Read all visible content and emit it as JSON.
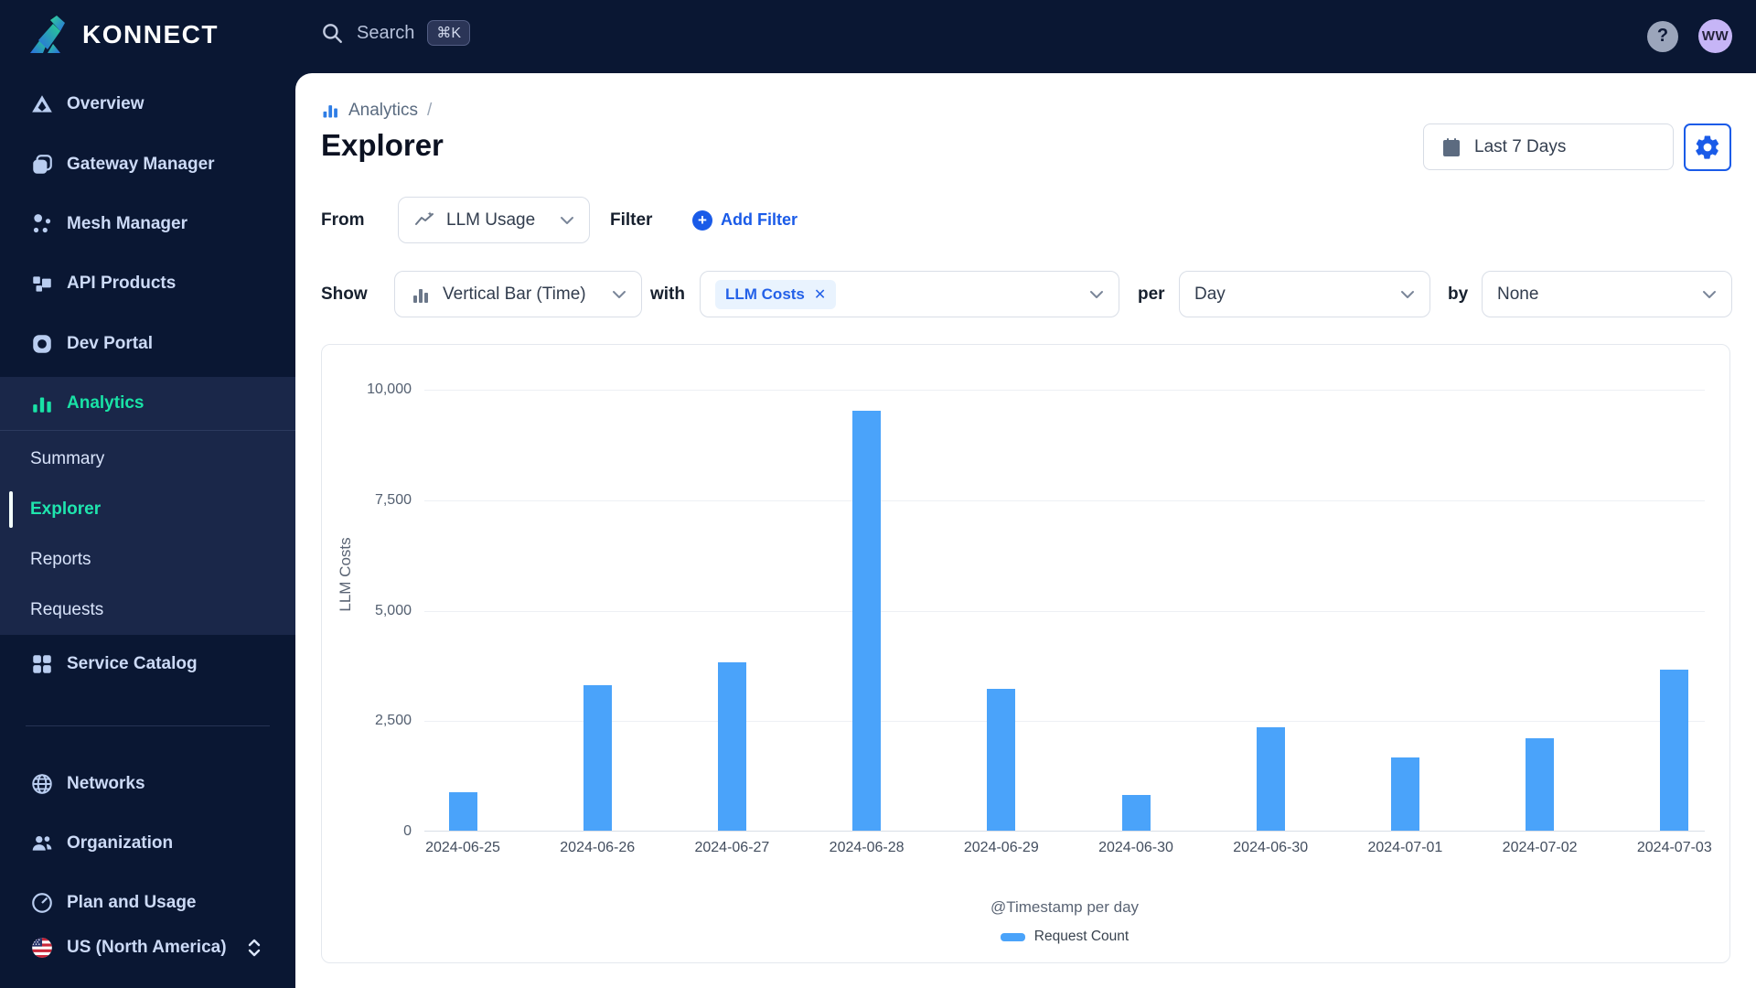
{
  "brand": {
    "logo_text": "KONNECT"
  },
  "topbar": {
    "search_label": "Search",
    "search_shortcut": "⌘K",
    "help_label": "?",
    "avatar_initials": "WW"
  },
  "sidebar": {
    "items": [
      {
        "label": "Overview"
      },
      {
        "label": "Gateway Manager"
      },
      {
        "label": "Mesh Manager"
      },
      {
        "label": "API Products"
      },
      {
        "label": "Dev Portal"
      },
      {
        "label": "Analytics",
        "active": true,
        "children": [
          {
            "label": "Summary"
          },
          {
            "label": "Explorer",
            "active": true
          },
          {
            "label": "Reports"
          },
          {
            "label": "Requests"
          }
        ]
      },
      {
        "label": "Service Catalog"
      },
      {
        "label": "Networks"
      },
      {
        "label": "Organization"
      },
      {
        "label": "Plan and Usage"
      },
      {
        "label": "US (North America)"
      }
    ]
  },
  "header": {
    "breadcrumb": "Analytics",
    "breadcrumb_sep": "/",
    "title": "Explorer",
    "date_range": "Last 7 Days"
  },
  "query": {
    "from_label": "From",
    "from_value": "LLM Usage",
    "filter_label": "Filter",
    "add_filter_label": "Add Filter",
    "show_label": "Show",
    "chart_type_value": "Vertical Bar (Time)",
    "with_label": "with",
    "metric_chip": "LLM Costs",
    "per_label": "per",
    "per_value": "Day",
    "by_label": "by",
    "by_value": "None"
  },
  "chart_data": {
    "type": "bar",
    "title": "",
    "ylabel": "LLM Costs",
    "xlabel": "@Timestamp per day",
    "legend": [
      "Request Count"
    ],
    "legend_position": "bottom",
    "grid": true,
    "categories": [
      "2024-06-25",
      "2024-06-26",
      "2024-06-27",
      "2024-06-28",
      "2024-06-29",
      "2024-06-30",
      "2024-06-30",
      "2024-07-01",
      "2024-07-02",
      "2024-07-03"
    ],
    "values": [
      870,
      3300,
      3800,
      9500,
      3200,
      800,
      2350,
      1650,
      2100,
      3650
    ],
    "ylim": [
      0,
      10000
    ],
    "ytick_labels": [
      "0",
      "2,500",
      "5,000",
      "7,500",
      "10,000"
    ],
    "bar_color": "#4aa3fa"
  },
  "colors": {
    "accent_blue": "#1a5be8",
    "accent_teal": "#19e2a6",
    "bar_blue": "#4aa3fa",
    "sidebar_bg": "#0a1733"
  }
}
